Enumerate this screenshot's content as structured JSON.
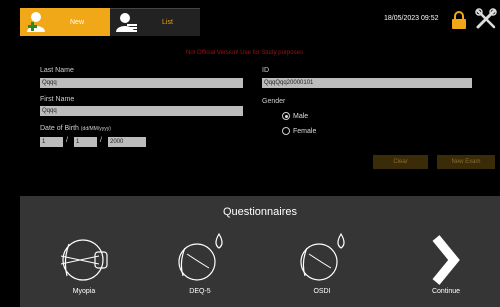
{
  "tabs": [
    {
      "label": "New",
      "icon": "add-user-icon",
      "active": true
    },
    {
      "label": "List",
      "icon": "user-list-icon",
      "active": false
    }
  ],
  "header": {
    "datetime": "18/05/2023 09:52",
    "lock_icon": "lock-icon",
    "tools_icon": "tools-icon"
  },
  "form": {
    "watermark": "Not Official Version! Use for Study purposes",
    "last_name_label": "Last Name",
    "last_name_value": "Qqqq",
    "first_name_label": "First Name",
    "first_name_value": "Qqqq",
    "dob_label": "Date of Birth",
    "dob_format": "(dd/MM/yyyy)",
    "dob_day": "1",
    "dob_month": "1",
    "dob_year": "2000",
    "slash": "/",
    "id_label": "ID",
    "id_value": "QqqQqq20000101",
    "gender_label": "Gender",
    "gender_options": [
      {
        "label": "Male",
        "selected": true
      },
      {
        "label": "Female",
        "selected": false
      }
    ],
    "clear_button": "Clear",
    "new_exam_button": "New Exam"
  },
  "questionnaires": {
    "title": "Questionnaires",
    "items": [
      {
        "label": "Myopia",
        "icon": "eye-icon"
      },
      {
        "label": "DEQ-5",
        "icon": "dry-eye-icon"
      },
      {
        "label": "OSDI",
        "icon": "dry-eye-icon"
      },
      {
        "label": "Continue",
        "icon": "chevron-right-icon"
      }
    ]
  },
  "colors": {
    "accent": "#f0a818",
    "panel": "#353535",
    "field": "#bcbcbc",
    "watermark": "#a01010"
  }
}
